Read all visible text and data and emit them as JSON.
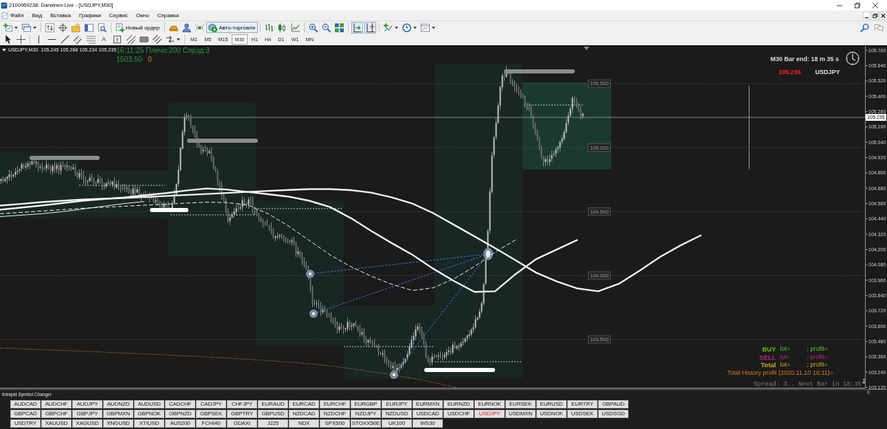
{
  "window": {
    "title": "2100069238: Darwinex-Live - [USDJPY,M30]"
  },
  "menu": [
    "Файл",
    "Вид",
    "Вставка",
    "Графики",
    "Сервис",
    "Окно",
    "Справка"
  ],
  "toolbar": {
    "new_order": "Новый ордер",
    "autotrading": {
      "label": "Авто-торговля",
      "pressed": true
    },
    "autoscroll": {
      "pressed": true
    },
    "chart_shift": {
      "pressed": true
    }
  },
  "drawing_toolbar": {
    "text_tool": "A",
    "label_tool": "T",
    "timeframes": [
      {
        "label": "M1",
        "selected": false
      },
      {
        "label": "M5",
        "selected": false
      },
      {
        "label": "M15",
        "selected": false
      },
      {
        "label": "M30",
        "selected": true
      },
      {
        "label": "H1",
        "selected": false
      },
      {
        "label": "H4",
        "selected": false
      },
      {
        "label": "D1",
        "selected": false
      },
      {
        "label": "W1",
        "selected": false
      },
      {
        "label": "MN",
        "selected": false
      }
    ]
  },
  "chart": {
    "symbol": "USDJPY,M30",
    "quotes": "105.245 105.288 105.234 105.235",
    "status": "16:11:25 Плечо:200 Спрэд:3",
    "balance": "1503.50",
    "balance_change": "0",
    "bar_timer": "M30 Bar end: 18 m 35 s",
    "last_price": "105.235",
    "price_symbol": "USDJPY",
    "level_labels": [
      "105.500",
      "105.000",
      "104.500",
      "104.000",
      "103.500"
    ],
    "current_price": "105.235",
    "chart_data": {
      "type": "line",
      "categories": [
        null,
        null,
        null,
        null,
        null,
        null,
        null,
        null,
        null,
        null,
        null,
        null,
        null,
        null,
        null,
        null,
        null,
        null,
        null,
        null,
        null,
        null,
        null,
        null,
        null,
        null,
        null,
        null,
        null,
        null,
        null,
        null,
        null,
        null,
        null
      ],
      "ylim": [
        103.117,
        105.794
      ],
      "yticks": [
        {
          "value": 105.76,
          "label": "105.760"
        },
        {
          "value": 105.64,
          "label": "105.640"
        },
        {
          "value": 105.52,
          "label": "105.520"
        },
        {
          "value": 105.4,
          "label": "105.400"
        },
        {
          "value": 105.28,
          "label": "105.280"
        },
        {
          "value": 105.16,
          "label": "105.160"
        },
        {
          "value": 105.04,
          "label": "105.040"
        },
        {
          "value": 104.92,
          "label": "104.920"
        },
        {
          "value": 104.8,
          "label": "104.800"
        },
        {
          "value": 104.68,
          "label": "104.680"
        },
        {
          "value": 104.56,
          "label": "104.560"
        },
        {
          "value": 104.44,
          "label": "104.440"
        },
        {
          "value": 104.32,
          "label": "104.320"
        },
        {
          "value": 104.2,
          "label": "104.200"
        },
        {
          "value": 104.08,
          "label": "104.080"
        },
        {
          "value": 103.96,
          "label": "103.960"
        },
        {
          "value": 103.84,
          "label": "103.840"
        },
        {
          "value": 103.72,
          "label": "103.720"
        },
        {
          "value": 103.6,
          "label": "103.600"
        },
        {
          "value": 103.48,
          "label": "103.480"
        },
        {
          "value": 103.36,
          "label": "103.360"
        },
        {
          "value": 103.24,
          "label": "103.240"
        },
        {
          "value": 103.12,
          "label": "103.120"
        }
      ],
      "series": [
        {
          "color": "#f2f2f2",
          "line_style": "solid",
          "values": [
            104.512,
            104.528,
            104.544,
            104.563,
            104.582,
            104.595,
            104.608,
            104.625,
            104.641,
            104.662,
            104.678,
            104.67,
            104.651,
            104.633,
            104.614,
            104.582,
            104.533,
            104.447,
            104.346,
            104.249,
            104.158,
            104.05,
            103.954,
            103.868,
            103.873,
            104.008,
            104.126,
            104.201,
            104.276,
            null,
            null,
            null,
            null,
            null,
            null
          ]
        },
        {
          "color": "#f2f2f2",
          "line_style": "solid",
          "values": [
            104.544,
            104.557,
            104.571,
            104.582,
            104.592,
            104.598,
            104.603,
            104.611,
            104.619,
            104.627,
            104.635,
            104.643,
            104.651,
            104.659,
            104.667,
            104.673,
            104.673,
            104.665,
            104.646,
            104.608,
            104.56,
            104.485,
            104.394,
            104.303,
            104.211,
            104.115,
            104.018,
            103.949,
            103.895,
            103.873,
            103.932,
            104.034,
            104.142,
            104.233,
            104.313
          ]
        },
        {
          "color": "#f2f2f2",
          "line_style": "dashed",
          "values": [
            104.48,
            104.49,
            104.501,
            104.512,
            104.523,
            104.531,
            104.539,
            104.547,
            104.555,
            104.563,
            104.571,
            104.568,
            104.549,
            104.48,
            104.383,
            104.27,
            104.158,
            104.067,
            103.991,
            103.927,
            103.879,
            103.9,
            103.97,
            104.067,
            104.179,
            104.276,
            null,
            null,
            null,
            null,
            null,
            null,
            null,
            null,
            null
          ]
        },
        {
          "color": "#f2f2f2",
          "line_style": "solid",
          "values": [
            104.458,
            104.469,
            104.48,
            104.496,
            104.517,
            104.539,
            104.56,
            104.576,
            null,
            null,
            null,
            null,
            null,
            null,
            null,
            null,
            null,
            null,
            null,
            null,
            null,
            null,
            null,
            null,
            null,
            null,
            null,
            null,
            null,
            null,
            null,
            null,
            null,
            null,
            null
          ]
        }
      ]
    },
    "positions": [
      {
        "label": "BUY",
        "lot": "lot=",
        "profit": "; profit=",
        "color": "#5ac81e"
      },
      {
        "label": "SELL",
        "lot": "lot=",
        "profit": "; profit=",
        "color": "#c81e8c"
      },
      {
        "label": "Total",
        "lot": "lot=",
        "profit": "; profit=",
        "color": "#c8b41e"
      }
    ],
    "history_profit": "Total History profit (2020.11.10 16:11)=",
    "spread_info": "Spread: 3.. Next Bar in 18:35"
  },
  "symbol_changer": {
    "title": "Intrepid Symbol Changer",
    "scale_label": "0",
    "rows": [
      [
        {
          "label": "AUDCAD",
          "selected": false
        },
        {
          "label": "AUDCHF",
          "selected": false
        },
        {
          "label": "AUDJPY",
          "selected": false
        },
        {
          "label": "AUDNZD",
          "selected": false
        },
        {
          "label": "AUDUSD",
          "selected": false
        },
        {
          "label": "CADCHF",
          "selected": false
        },
        {
          "label": "CADJPY",
          "selected": false
        },
        {
          "label": "CHFJPY",
          "selected": false
        },
        {
          "label": "EURAUD",
          "selected": false
        },
        {
          "label": "EURCAD",
          "selected": false
        },
        {
          "label": "EURCHF",
          "selected": false
        },
        {
          "label": "EURGBP",
          "selected": false
        },
        {
          "label": "EURJPY",
          "selected": false
        },
        {
          "label": "EURMXN",
          "selected": false
        },
        {
          "label": "EURNZD",
          "selected": false
        },
        {
          "label": "EURNOK",
          "selected": false
        },
        {
          "label": "EURSEK",
          "selected": false
        },
        {
          "label": "EURUSD",
          "selected": false
        },
        {
          "label": "EURTRY",
          "selected": false
        },
        {
          "label": "GBPAUD",
          "selected": false
        }
      ],
      [
        {
          "label": "GBPCAD",
          "selected": false
        },
        {
          "label": "GBPCHF",
          "selected": false
        },
        {
          "label": "GBPJPY",
          "selected": false
        },
        {
          "label": "GBPMXN",
          "selected": false
        },
        {
          "label": "GBPNOK",
          "selected": false
        },
        {
          "label": "GBPNZD",
          "selected": false
        },
        {
          "label": "GBPSEK",
          "selected": false
        },
        {
          "label": "GBPTRY",
          "selected": false
        },
        {
          "label": "GBPUSD",
          "selected": false
        },
        {
          "label": "NZDCAD",
          "selected": false
        },
        {
          "label": "NZDCHF",
          "selected": false
        },
        {
          "label": "NZDJPY",
          "selected": false
        },
        {
          "label": "NZDUSD",
          "selected": false
        },
        {
          "label": "USDCAD",
          "selected": false
        },
        {
          "label": "USDCHF",
          "selected": false
        },
        {
          "label": "USDJPY",
          "selected": true
        },
        {
          "label": "USDMXN",
          "selected": false
        },
        {
          "label": "USDNOK",
          "selected": false
        },
        {
          "label": "USDSEK",
          "selected": false
        },
        {
          "label": "USDSGD",
          "selected": false
        }
      ],
      [
        {
          "label": "USDTRY",
          "selected": false
        },
        {
          "label": "XAUUSD",
          "selected": false
        },
        {
          "label": "XAGUSD",
          "selected": false
        },
        {
          "label": "XNGUSD",
          "selected": false
        },
        {
          "label": "XTIUSD",
          "selected": false
        },
        {
          "label": "AUS200",
          "selected": false
        },
        {
          "label": "FCHI40",
          "selected": false
        },
        {
          "label": "GDAXI",
          "selected": false
        },
        {
          "label": "J225",
          "selected": false
        },
        {
          "label": "NDX",
          "selected": false
        },
        {
          "label": "SPX500",
          "selected": false
        },
        {
          "label": "STOXX50E",
          "selected": false
        },
        {
          "label": "UK100",
          "selected": false
        },
        {
          "label": "WS30",
          "selected": false
        }
      ]
    ]
  }
}
